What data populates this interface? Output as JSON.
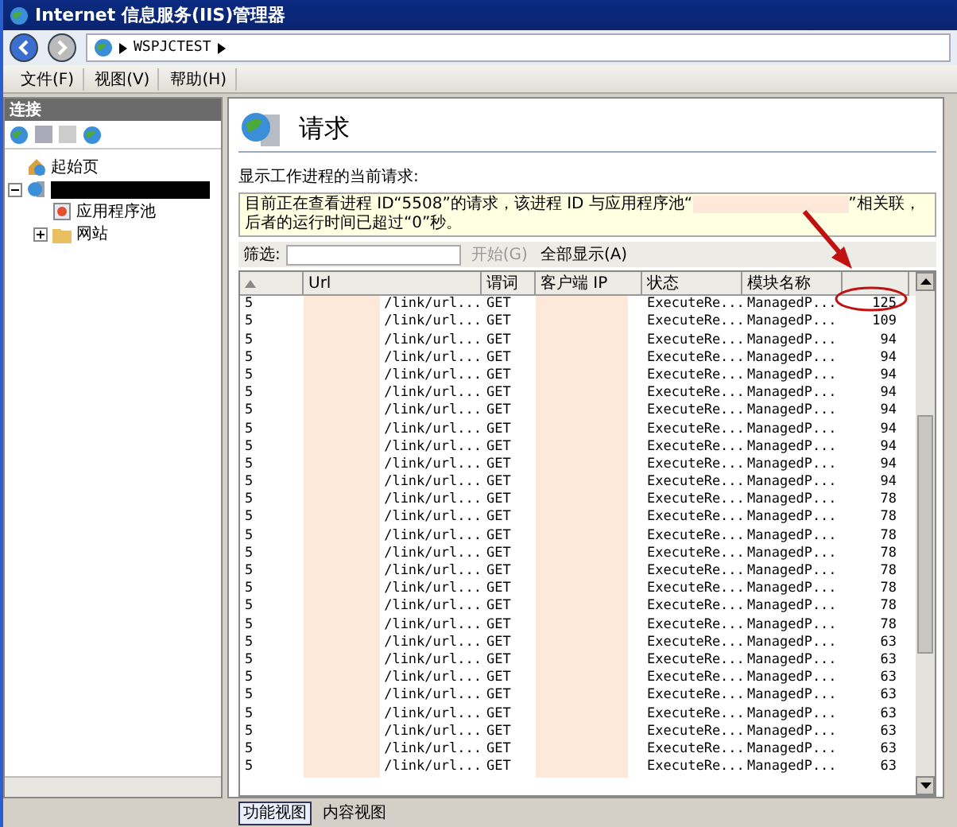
{
  "window": {
    "title": "Internet 信息服务(IIS)管理器"
  },
  "address": {
    "segments": [
      "WSPJCTEST"
    ]
  },
  "menu": [
    "文件(F)",
    "视图(V)",
    "帮助(H)"
  ],
  "connections": {
    "title": "连接",
    "tree": [
      {
        "label": "起始页",
        "kind": "start"
      },
      {
        "kind": "server",
        "expanded": true,
        "children": [
          {
            "label": "应用程序池",
            "kind": "pools"
          },
          {
            "label": "网站",
            "kind": "sites",
            "expanded": false
          }
        ]
      }
    ]
  },
  "page": {
    "title": "请求",
    "description": "显示工作进程的当前请求:",
    "info_before": "目前正在查看进程 ID“5508”的请求，该进程 ID 与应用程序池“",
    "info_after": "”相关联，后者的运行时间已超过“0”秒。"
  },
  "filter": {
    "label": "筛选:",
    "start": "开始(G)",
    "start_disabled": true,
    "show_all": "全部显示(A)"
  },
  "table": {
    "columns": [
      {
        "sorted": true
      },
      {
        "label": "Url",
        "sorted": false
      },
      {
        "label": "谓词",
        "sorted": false
      },
      {
        "label": "客户端 IP",
        "sorted": false
      },
      {
        "label": "状态",
        "sorted": false
      },
      {
        "label": "模块名称",
        "sorted": false
      },
      {
        "sorted": false
      }
    ],
    "rows": [
      [
        "5",
        "/link/url...",
        "GET",
        "",
        "ExecuteRe...",
        "ManagedP...",
        "125"
      ],
      [
        "5",
        "/link/url...",
        "GET",
        "",
        "ExecuteRe...",
        "ManagedP...",
        "109"
      ],
      [
        "5",
        "/link/url...",
        "GET",
        "",
        "ExecuteRe...",
        "ManagedP...",
        "94"
      ],
      [
        "5",
        "/link/url...",
        "GET",
        "",
        "ExecuteRe...",
        "ManagedP...",
        "94"
      ],
      [
        "5",
        "/link/url...",
        "GET",
        "",
        "ExecuteRe...",
        "ManagedP...",
        "94"
      ],
      [
        "5",
        "/link/url...",
        "GET",
        "",
        "ExecuteRe...",
        "ManagedP...",
        "94"
      ],
      [
        "5",
        "/link/url...",
        "GET",
        "",
        "ExecuteRe...",
        "ManagedP...",
        "94"
      ],
      [
        "5",
        "/link/url...",
        "GET",
        "",
        "ExecuteRe...",
        "ManagedP...",
        "94"
      ],
      [
        "5",
        "/link/url...",
        "GET",
        "",
        "ExecuteRe...",
        "ManagedP...",
        "94"
      ],
      [
        "5",
        "/link/url...",
        "GET",
        "",
        "ExecuteRe...",
        "ManagedP...",
        "94"
      ],
      [
        "5",
        "/link/url...",
        "GET",
        "",
        "ExecuteRe...",
        "ManagedP...",
        "94"
      ],
      [
        "5",
        "/link/url...",
        "GET",
        "",
        "ExecuteRe...",
        "ManagedP...",
        "78"
      ],
      [
        "5",
        "/link/url...",
        "GET",
        "",
        "ExecuteRe...",
        "ManagedP...",
        "78"
      ],
      [
        "5",
        "/link/url...",
        "GET",
        "",
        "ExecuteRe...",
        "ManagedP...",
        "78"
      ],
      [
        "5",
        "/link/url...",
        "GET",
        "",
        "ExecuteRe...",
        "ManagedP...",
        "78"
      ],
      [
        "5",
        "/link/url...",
        "GET",
        "",
        "ExecuteRe...",
        "ManagedP...",
        "78"
      ],
      [
        "5",
        "/link/url...",
        "GET",
        "",
        "ExecuteRe...",
        "ManagedP...",
        "78"
      ],
      [
        "5",
        "/link/url...",
        "GET",
        "",
        "ExecuteRe...",
        "ManagedP...",
        "78"
      ],
      [
        "5",
        "/link/url...",
        "GET",
        "",
        "ExecuteRe...",
        "ManagedP...",
        "78"
      ],
      [
        "5",
        "/link/url...",
        "GET",
        "",
        "ExecuteRe...",
        "ManagedP...",
        "63"
      ],
      [
        "5",
        "/link/url...",
        "GET",
        "",
        "ExecuteRe...",
        "ManagedP...",
        "63"
      ],
      [
        "5",
        "/link/url...",
        "GET",
        "",
        "ExecuteRe...",
        "ManagedP...",
        "63"
      ],
      [
        "5",
        "/link/url...",
        "GET",
        "",
        "ExecuteRe...",
        "ManagedP...",
        "63"
      ],
      [
        "5",
        "/link/url...",
        "GET",
        "",
        "ExecuteRe...",
        "ManagedP...",
        "63"
      ],
      [
        "5",
        "/link/url...",
        "GET",
        "",
        "ExecuteRe...",
        "ManagedP...",
        "63"
      ],
      [
        "5",
        "/link/url...",
        "GET",
        "",
        "ExecuteRe...",
        "ManagedP...",
        "63"
      ],
      [
        "5",
        "/link/url...",
        "GET",
        "",
        "ExecuteRe...",
        "ManagedP...",
        "63"
      ]
    ]
  },
  "view_tabs": [
    {
      "label": "功能视图",
      "selected": true
    },
    {
      "label": "内容视图",
      "selected": false
    }
  ]
}
